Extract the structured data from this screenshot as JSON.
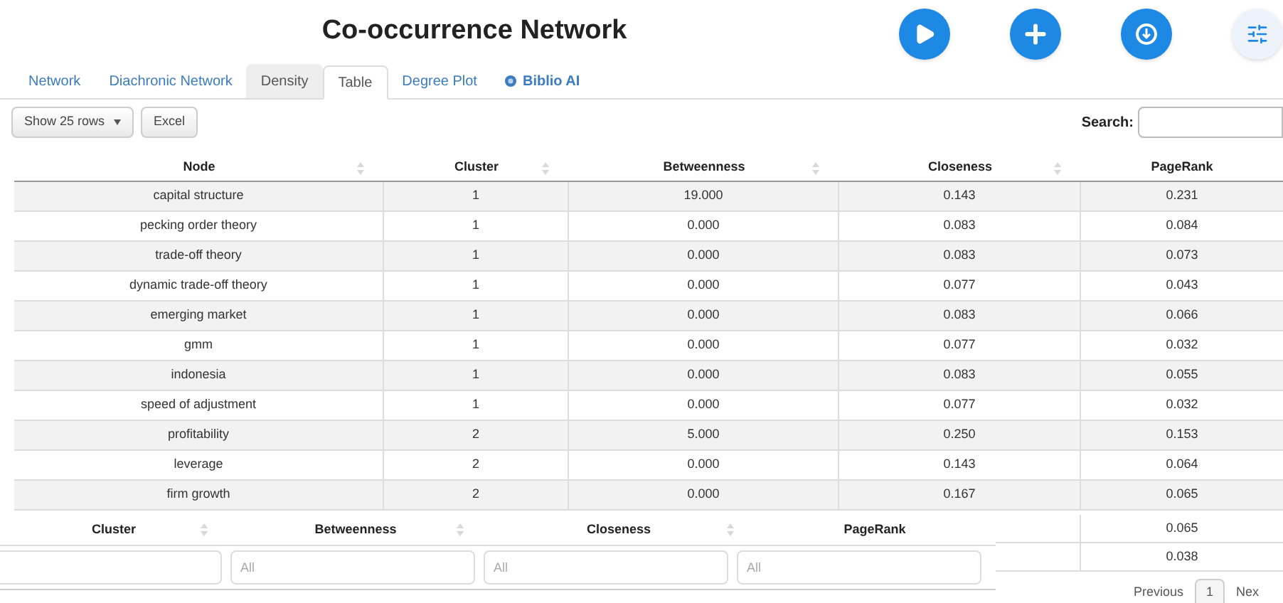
{
  "title": "Co-occurrence Network",
  "toolbar_icons": [
    {
      "kind": "play"
    },
    {
      "kind": "add"
    },
    {
      "kind": "download"
    },
    {
      "kind": "settings"
    }
  ],
  "tabs": [
    {
      "label": "Network",
      "selected": false,
      "highlighted": false
    },
    {
      "label": "Diachronic Network",
      "selected": false,
      "highlighted": false
    },
    {
      "label": "Density",
      "selected": false,
      "highlighted": true
    },
    {
      "label": "Table",
      "selected": true,
      "highlighted": false
    },
    {
      "label": "Degree Plot",
      "selected": false,
      "highlighted": false
    },
    {
      "label": "Biblio AI",
      "selected": false,
      "highlighted": false,
      "kind": "ai"
    }
  ],
  "controls": {
    "rows_button": "Show 25 rows",
    "excel_button": "Excel",
    "search_label": "Search:"
  },
  "table": {
    "columns": [
      {
        "label": "Node",
        "sortable": true
      },
      {
        "label": "Cluster",
        "sortable": true
      },
      {
        "label": "Betweenness",
        "sortable": true
      },
      {
        "label": "Closeness",
        "sortable": true
      },
      {
        "label": "PageRank",
        "sortable": false
      }
    ],
    "rows": [
      [
        "capital structure",
        "1",
        "19.000",
        "0.143",
        "0.231"
      ],
      [
        "pecking order theory",
        "1",
        "0.000",
        "0.083",
        "0.084"
      ],
      [
        "trade-off theory",
        "1",
        "0.000",
        "0.083",
        "0.073"
      ],
      [
        "dynamic trade-off theory",
        "1",
        "0.000",
        "0.077",
        "0.043"
      ],
      [
        "emerging market",
        "1",
        "0.000",
        "0.083",
        "0.066"
      ],
      [
        "gmm",
        "1",
        "0.000",
        "0.077",
        "0.032"
      ],
      [
        "indonesia",
        "1",
        "0.000",
        "0.083",
        "0.055"
      ],
      [
        "speed of adjustment",
        "1",
        "0.000",
        "0.077",
        "0.032"
      ],
      [
        "profitability",
        "2",
        "5.000",
        "0.250",
        "0.153"
      ],
      [
        "leverage",
        "2",
        "0.000",
        "0.143",
        "0.064"
      ],
      [
        "firm growth",
        "2",
        "0.000",
        "0.167",
        "0.065"
      ]
    ]
  },
  "floating_header": {
    "columns": [
      {
        "label": "Cluster",
        "sortable": true
      },
      {
        "label": "Betweenness",
        "sortable": true
      },
      {
        "label": "Closeness",
        "sortable": true
      },
      {
        "label": "PageRank",
        "sortable": false
      }
    ],
    "filters": [
      {
        "kind": "cut"
      },
      {
        "kind": "text",
        "placeholder": "All"
      },
      {
        "kind": "text",
        "placeholder": "All"
      },
      {
        "kind": "text",
        "placeholder": "All"
      }
    ]
  },
  "more_pagerank": [
    "0.065",
    "0.038"
  ],
  "pagination": {
    "previous": "Previous",
    "page": "1",
    "next": "Nex"
  }
}
